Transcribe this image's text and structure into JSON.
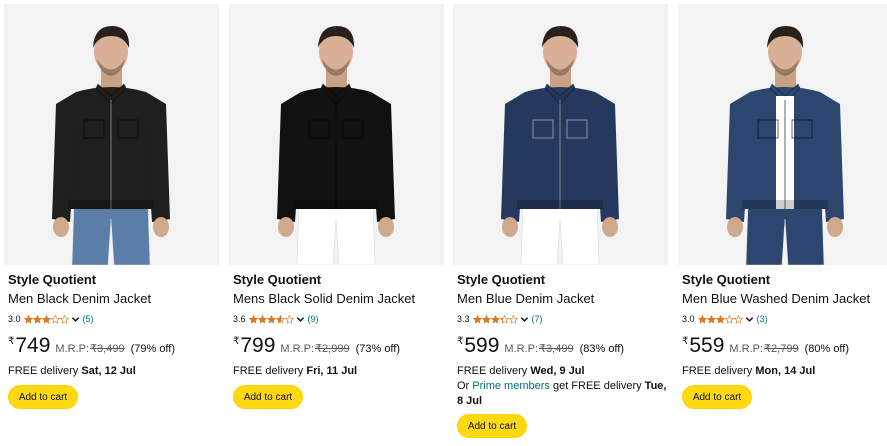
{
  "products": [
    {
      "brand": "Style Quotient",
      "title": "Men Black Denim Jacket",
      "rating": "3.0",
      "rating_value": 3.0,
      "review_count": "(5)",
      "currency": "₹",
      "price": "749",
      "mrp_label": "M.R.P:",
      "mrp": "₹3,499",
      "discount": "(79% off)",
      "delivery_prefix": "FREE delivery ",
      "delivery_date": "Sat, 12 Jul",
      "cart_label": "Add to cart",
      "jacket_color": "#1f1f1f",
      "jeans_color": "#5a7ea8",
      "style": "zip"
    },
    {
      "brand": "Style Quotient",
      "title": "Mens Black Solid Denim Jacket",
      "rating": "3.6",
      "rating_value": 3.6,
      "review_count": "(9)",
      "currency": "₹",
      "price": "799",
      "mrp_label": "M.R.P:",
      "mrp": "₹2,999",
      "discount": "(73% off)",
      "delivery_prefix": "FREE delivery ",
      "delivery_date": "Fri, 11 Jul",
      "cart_label": "Add to cart",
      "jacket_color": "#111111",
      "jeans_color": "#ffffff",
      "style": "button"
    },
    {
      "brand": "Style Quotient",
      "title": "Men Blue Denim Jacket",
      "rating": "3.3",
      "rating_value": 3.3,
      "review_count": "(7)",
      "currency": "₹",
      "price": "599",
      "mrp_label": "M.R.P:",
      "mrp": "₹3,499",
      "discount": "(83% off)",
      "delivery_prefix": "FREE delivery ",
      "delivery_date": "Wed, 9 Jul",
      "prime_prefix": "Or ",
      "prime_link": "Prime members",
      "prime_middle": " get FREE delivery ",
      "prime_date": "Tue, 8 Jul",
      "cart_label": "Add to cart",
      "jacket_color": "#25395e",
      "jeans_color": "#ffffff",
      "style": "zip"
    },
    {
      "brand": "Style Quotient",
      "title": "Men Blue Washed Denim Jacket",
      "rating": "3.0",
      "rating_value": 3.0,
      "review_count": "(3)",
      "currency": "₹",
      "price": "559",
      "mrp_label": "M.R.P:",
      "mrp": "₹2,799",
      "discount": "(80% off)",
      "delivery_prefix": "FREE delivery ",
      "delivery_date": "Mon, 14 Jul",
      "cart_label": "Add to cart",
      "jacket_color": "#2c4670",
      "jeans_color": "#2c4670",
      "style": "open"
    }
  ],
  "colors": {
    "star": "#de7921",
    "link": "#007185",
    "button": "#ffd814",
    "image_bg": "#f3f3f3"
  },
  "icons": {
    "star": "star-icon",
    "chevron": "chevron-down-icon"
  }
}
